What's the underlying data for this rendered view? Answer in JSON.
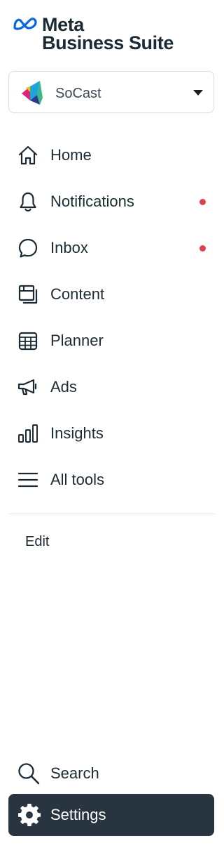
{
  "logo": {
    "line1": "Meta",
    "line2": "Business Suite",
    "brand_color": "#0668e1"
  },
  "account": {
    "name": "SoCast",
    "avatar_icon": "socast-logo",
    "caret_icon": "caret-down-icon"
  },
  "nav": {
    "items": [
      {
        "label": "Home",
        "icon": "home-icon",
        "badge": false
      },
      {
        "label": "Notifications",
        "icon": "bell-icon",
        "badge": true
      },
      {
        "label": "Inbox",
        "icon": "chat-bubble-icon",
        "badge": true
      },
      {
        "label": "Content",
        "icon": "content-icon",
        "badge": false
      },
      {
        "label": "Planner",
        "icon": "calendar-grid-icon",
        "badge": false
      },
      {
        "label": "Ads",
        "icon": "megaphone-icon",
        "badge": false
      },
      {
        "label": "Insights",
        "icon": "bar-chart-icon",
        "badge": false
      },
      {
        "label": "All tools",
        "icon": "menu-lines-icon",
        "badge": false
      }
    ],
    "badge_color": "#e0404c"
  },
  "edit_label": "Edit",
  "search": {
    "label": "Search",
    "icon": "search-icon"
  },
  "settings": {
    "label": "Settings",
    "icon": "gear-icon",
    "active_color": "#283541"
  }
}
